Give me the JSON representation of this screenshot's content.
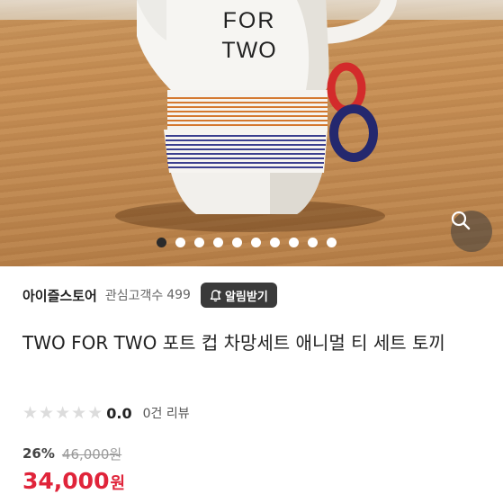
{
  "product_image": {
    "mug_text_line1": "FOR",
    "mug_text_line2": "TWO",
    "slide_count": 10,
    "active_slide": 1
  },
  "zoom": {
    "icon": "search-icon"
  },
  "store": {
    "name": "아이즐스토어",
    "interest_label": "관심고객수",
    "interest_count": "499",
    "alert_button": "알림받기",
    "alert_icon": "bell-plus-icon"
  },
  "product": {
    "title": "TWO FOR TWO 포트 컵 차망세트 애니멀 티 세트 토끼"
  },
  "rating": {
    "stars_filled": 0,
    "stars_total": 5,
    "value": "0.0",
    "review_count": "0건 리뷰"
  },
  "price": {
    "discount": "26%",
    "original": "46,000원",
    "current": "34,000",
    "unit": "원"
  },
  "colors": {
    "price_red": "#e0243a",
    "alert_button_bg": "#3a3a3a",
    "active_dot": "#2b2b2b",
    "star_empty": "#dcdcdc"
  }
}
